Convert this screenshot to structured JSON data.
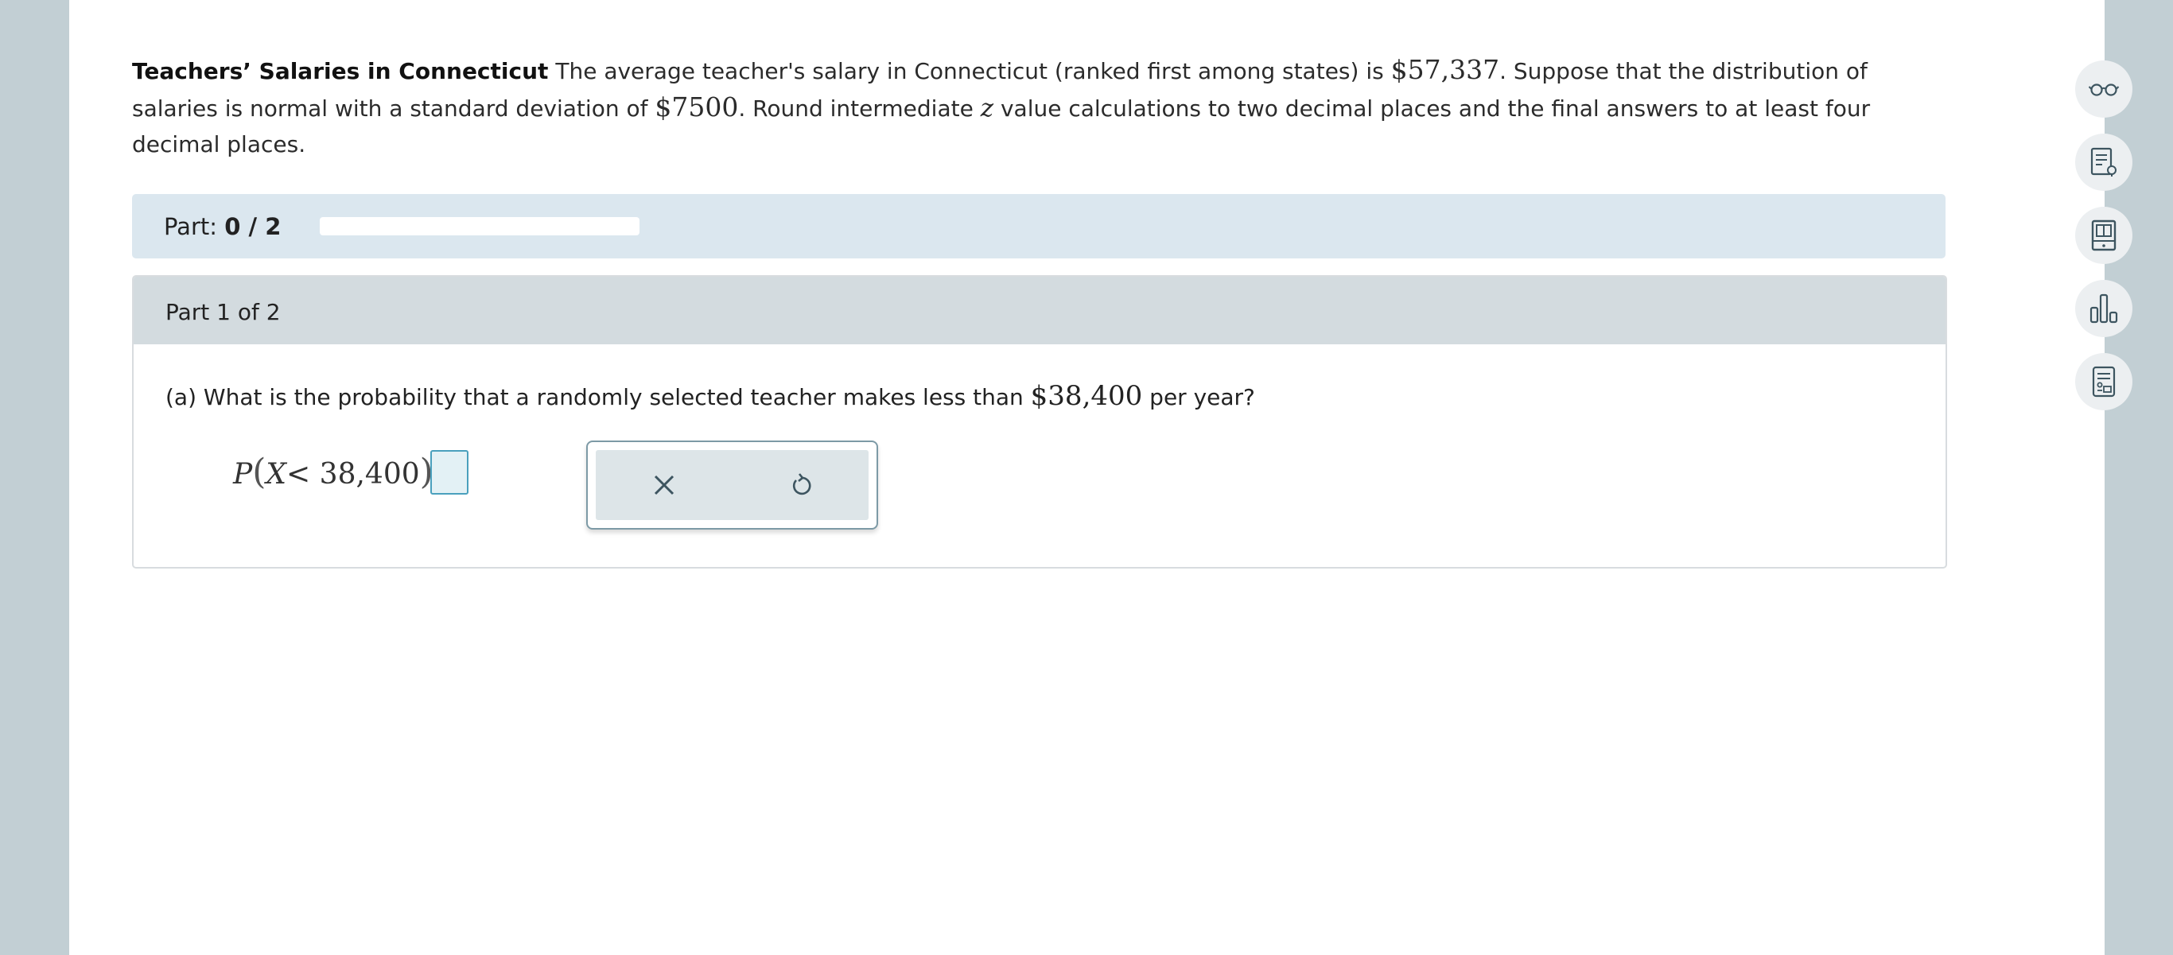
{
  "problem": {
    "title": "Teachers’ Salaries in Connecticut",
    "text1": " The average teacher's salary in Connecticut (ranked first among states) is ",
    "mean": "$57,337",
    "text2": ". Suppose that the distribution of salaries is normal with a standard deviation of ",
    "sd": "$7500",
    "text3": ". Round intermediate ",
    "zvar": "z",
    "text4": " value calculations to two decimal places and the final answers to at least four decimal places."
  },
  "progress": {
    "label": "Part:",
    "value": "0 / 2",
    "fraction": 0
  },
  "part": {
    "header": "Part 1 of 2",
    "question_prefix": "(a)  What is the probability that a randomly selected teacher makes less than ",
    "question_value": "$38,400",
    "question_suffix": " per year?",
    "expr_p": "P",
    "expr_lparen": "(",
    "expr_x": "X",
    "expr_lt": "<",
    "expr_value": "38,400",
    "expr_rparen": ")",
    "expr_eq": "=",
    "answer": ""
  },
  "tools": {
    "clear_icon": "close-icon",
    "reset_icon": "undo-icon"
  },
  "sidebar": [
    {
      "icon": "glasses-icon"
    },
    {
      "icon": "explanation-icon"
    },
    {
      "icon": "textbook-icon"
    },
    {
      "icon": "data-chart-icon"
    },
    {
      "icon": "calculator-icon"
    }
  ],
  "colors": {
    "accent": "#4aa0bd",
    "icon": "#3d5560",
    "partbar_bg": "#dbe7ef",
    "card_header_bg": "#d3dbdf"
  }
}
